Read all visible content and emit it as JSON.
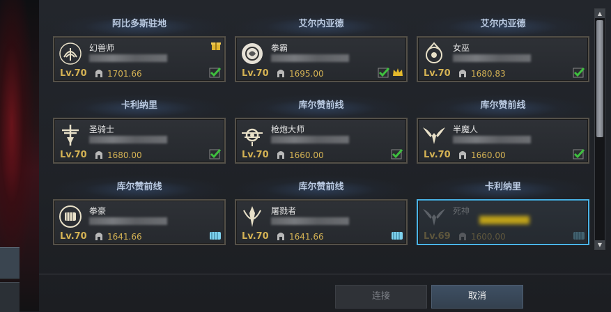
{
  "characters": [
    {
      "server": "阿比多斯驻地",
      "class": "幻兽师",
      "level": "Lv.70",
      "power": "1701.66",
      "emblem": "summoner-emblem-icon",
      "badges": [
        "check-icon"
      ],
      "gift": true
    },
    {
      "server": "艾尔内亚德",
      "class": "拳霸",
      "level": "Lv.70",
      "power": "1695.00",
      "emblem": "brawler-emblem-icon",
      "badges": [
        "check-icon",
        "crown-icon"
      ],
      "gift": false
    },
    {
      "server": "艾尔内亚德",
      "class": "女巫",
      "level": "Lv.70",
      "power": "1680.83",
      "emblem": "witch-emblem-icon",
      "badges": [
        "check-icon"
      ],
      "gift": false
    },
    {
      "server": "卡利纳里",
      "class": "圣骑士",
      "level": "Lv.70",
      "power": "1680.00",
      "emblem": "paladin-emblem-icon",
      "badges": [
        "check-icon"
      ],
      "gift": false
    },
    {
      "server": "库尔赞前线",
      "class": "枪炮大师",
      "level": "Lv.70",
      "power": "1660.00",
      "emblem": "gunner-emblem-icon",
      "badges": [
        "check-icon"
      ],
      "gift": false
    },
    {
      "server": "库尔赞前线",
      "class": "半魔人",
      "level": "Lv.70",
      "power": "1660.00",
      "emblem": "demonic-emblem-icon",
      "badges": [
        "check-icon"
      ],
      "gift": false
    },
    {
      "server": "库尔赞前线",
      "class": "拳豪",
      "level": "Lv.70",
      "power": "1641.66",
      "emblem": "fist-emblem-icon",
      "badges": [
        "fist-badge-icon"
      ],
      "gift": false
    },
    {
      "server": "库尔赞前线",
      "class": "屠戮者",
      "level": "Lv.70",
      "power": "1641.66",
      "emblem": "slayer-emblem-icon",
      "badges": [
        "fist-badge-icon"
      ],
      "gift": false
    },
    {
      "server": "卡利纳里",
      "class": "死神",
      "level": "Lv.69",
      "power": "1600.00",
      "emblem": "reaper-emblem-icon",
      "badges": [
        "fist-badge-icon"
      ],
      "gift": false,
      "selected": true
    }
  ],
  "buttons": {
    "connect": "连接",
    "cancel": "取消"
  },
  "scrollbar": {
    "up": "▲",
    "down": "▼"
  },
  "colors": {
    "gold": "#d4b254",
    "selected_border": "#4ab3e6",
    "check": "#3fbf3f"
  }
}
